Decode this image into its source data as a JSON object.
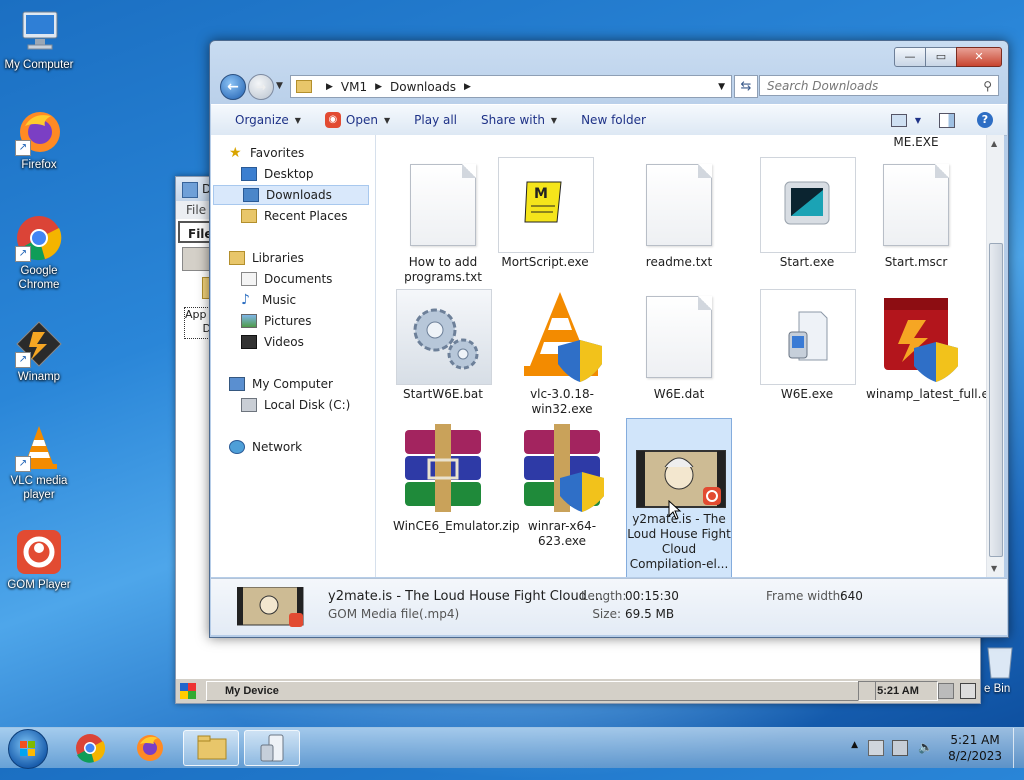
{
  "desktop": {
    "icons": [
      {
        "label": "My Computer"
      },
      {
        "label": "Firefox"
      },
      {
        "label": "Google Chrome"
      },
      {
        "label": "Winamp"
      },
      {
        "label": "VLC media player"
      },
      {
        "label": "GOM Player"
      }
    ],
    "recycle_bin_partial": "e Bin"
  },
  "ce_window": {
    "title_partial": "D",
    "menu_file": "File",
    "toolbar_file": "File",
    "folder_label_1": "App",
    "folder_label_2": "D",
    "statusbar": {
      "device": "My Device",
      "time": "5:21 AM"
    }
  },
  "explorer": {
    "caption": {
      "minimize": "—",
      "maximize": "▭",
      "close": "✕"
    },
    "address": {
      "crumbs": [
        "VM1",
        "Downloads"
      ]
    },
    "search": {
      "placeholder": "Search Downloads"
    },
    "toolbar": {
      "organize": "Organize",
      "open": "Open",
      "play_all": "Play all",
      "share_with": "Share with",
      "new_folder": "New folder"
    },
    "sidebar": {
      "favorites": "Favorites",
      "desktop": "Desktop",
      "downloads": "Downloads",
      "recent_places": "Recent Places",
      "libraries": "Libraries",
      "documents": "Documents",
      "music": "Music",
      "pictures": "Pictures",
      "videos": "Videos",
      "my_computer": "My Computer",
      "local_disk": "Local Disk (C:)",
      "network": "Network"
    },
    "files": [
      {
        "name": "ME.EXE"
      },
      {
        "name": "How to add programs.txt"
      },
      {
        "name": "MortScript.exe"
      },
      {
        "name": "readme.txt"
      },
      {
        "name": "Start.exe"
      },
      {
        "name": "Start.mscr"
      },
      {
        "name": "StartW6E.bat"
      },
      {
        "name": "vlc-3.0.18-win32.exe"
      },
      {
        "name": "W6E.dat"
      },
      {
        "name": "W6E.exe"
      },
      {
        "name": "winamp_latest_full.exe"
      },
      {
        "name": "WinCE6_Emulator.zip"
      },
      {
        "name": "winrar-x64-623.exe"
      },
      {
        "name": "y2mate.is - The Loud House Fight Cloud Compilation-el..."
      }
    ],
    "details": {
      "name": "y2mate.is - The Loud House Fight Cloud ...",
      "type": "GOM Media file(.mp4)",
      "length_label": "Length:",
      "length_value": "00:15:30",
      "size_label": "Size:",
      "size_value": "69.5 MB",
      "frame_width_label": "Frame width:",
      "frame_width_value": "640"
    }
  },
  "taskbar": {
    "clock": {
      "time": "5:21 AM",
      "date": "8/2/2023"
    }
  },
  "colors": {
    "accent": "#1e3287",
    "selection": "#cce2fa",
    "gom": "#e24b32"
  }
}
